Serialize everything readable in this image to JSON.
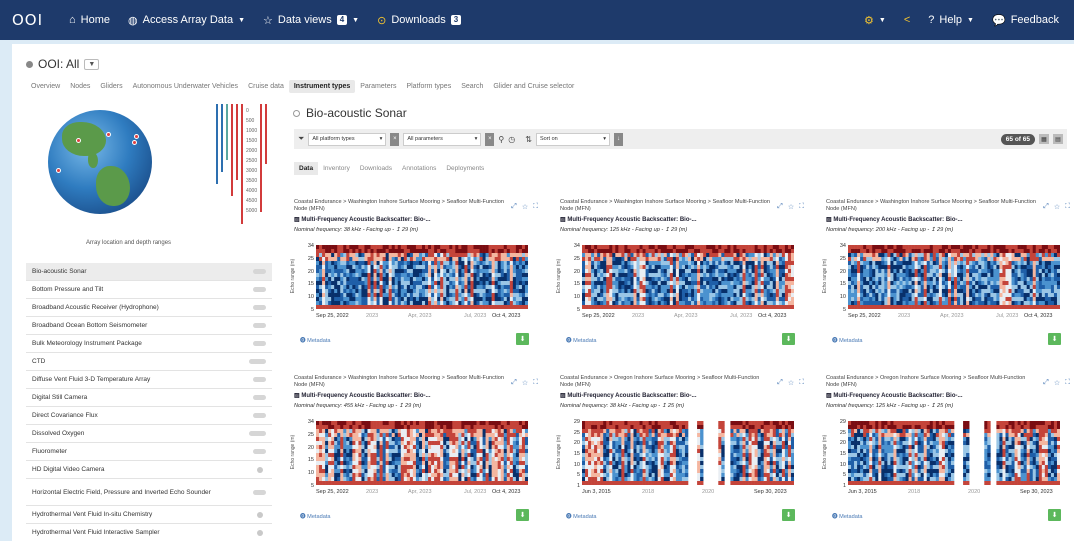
{
  "nav": {
    "logo": "OOI",
    "home": "Home",
    "access": "Access Array Data",
    "views": "Data views",
    "views_count": "4",
    "downloads": "Downloads",
    "downloads_count": "3",
    "help": "Help",
    "feedback": "Feedback"
  },
  "selector": {
    "label": "OOI: All"
  },
  "tabs": [
    "Overview",
    "Nodes",
    "Gliders",
    "Autonomous Underwater Vehicles",
    "Cruise data",
    "Instrument types",
    "Parameters",
    "Platform types",
    "Search",
    "Glider and Cruise selector"
  ],
  "active_tab": "Instrument types",
  "map": {
    "caption": "Array location and depth ranges",
    "depths": [
      "0",
      "500",
      "1000",
      "1500",
      "2000",
      "2500",
      "3000",
      "3500",
      "4000",
      "4500",
      "5000"
    ]
  },
  "instruments": [
    {
      "name": "Bio-acoustic Sonar",
      "active": true
    },
    {
      "name": "Bottom Pressure and Tilt"
    },
    {
      "name": "Broadband Acoustic Receiver (Hydrophone)"
    },
    {
      "name": "Broadband Ocean Bottom Seismometer"
    },
    {
      "name": "Bulk Meteorology Instrument Package"
    },
    {
      "name": "CTD"
    },
    {
      "name": "Diffuse Vent Fluid 3-D Temperature Array"
    },
    {
      "name": "Digital Still Camera"
    },
    {
      "name": "Direct Covariance Flux"
    },
    {
      "name": "Dissolved Oxygen"
    },
    {
      "name": "Fluorometer"
    },
    {
      "name": "HD Digital Video Camera"
    },
    {
      "name": "Horizontal Electric Field, Pressure and Inverted Echo Sounder"
    },
    {
      "name": "Hydrothermal Vent Fluid In-situ Chemistry"
    },
    {
      "name": "Hydrothermal Vent Fluid Interactive Sampler"
    }
  ],
  "main": {
    "title": "Bio-acoustic Sonar",
    "filter_platform": "All platform types",
    "filter_params": "All parameters",
    "sort": "Sort on",
    "count": "65 of 65",
    "subtabs": [
      "Data",
      "Inventory",
      "Downloads",
      "Annotations",
      "Deployments"
    ]
  },
  "cards": [
    {
      "path": "Coastal Endurance > Washington Inshore Surface Mooring > Seafloor Multi-Function Node (MFN)",
      "title": "Multi-Frequency Acoustic Backscatter: Bio-...",
      "subtitle": "Nominal frequency: 38 kHz - Facing up - ↥ 29 (m)",
      "ylabel": "Echo range (m)",
      "yticks": [
        "34",
        "25",
        "20",
        "15",
        "10",
        "5"
      ],
      "xticks": [
        "Sep 25, 2022",
        "2023",
        "Apr, 2023",
        "Jul, 2023",
        "Oct 4, 2023"
      ],
      "meta": "Metadata"
    },
    {
      "path": "Coastal Endurance > Washington Inshore Surface Mooring > Seafloor Multi-Function Node (MFN)",
      "title": "Multi-Frequency Acoustic Backscatter: Bio-...",
      "subtitle": "Nominal frequency: 125 kHz - Facing up - ↥ 29 (m)",
      "ylabel": "Echo range (m)",
      "yticks": [
        "34",
        "25",
        "20",
        "15",
        "10",
        "5"
      ],
      "xticks": [
        "Sep 25, 2022",
        "2023",
        "Apr, 2023",
        "Jul, 2023",
        "Oct 4, 2023"
      ],
      "meta": "Metadata"
    },
    {
      "path": "Coastal Endurance > Washington Inshore Surface Mooring > Seafloor Multi-Function Node (MFN)",
      "title": "Multi-Frequency Acoustic Backscatter: Bio-...",
      "subtitle": "Nominal frequency: 200 kHz - Facing up - ↥ 29 (m)",
      "ylabel": "Echo range (m)",
      "yticks": [
        "34",
        "25",
        "20",
        "15",
        "10",
        "5"
      ],
      "xticks": [
        "Sep 25, 2022",
        "2023",
        "Apr, 2023",
        "Jul, 2023",
        "Oct 4, 2023"
      ],
      "meta": "Metadata"
    },
    {
      "path": "Coastal Endurance > Washington Inshore Surface Mooring > Seafloor Multi-Function Node (MFN)",
      "title": "Multi-Frequency Acoustic Backscatter: Bio-...",
      "subtitle": "Nominal frequency: 455 kHz - Facing up - ↥ 29 (m)",
      "ylabel": "Echo range (m)",
      "yticks": [
        "34",
        "25",
        "20",
        "15",
        "10",
        "5"
      ],
      "xticks": [
        "Sep 25, 2022",
        "2023",
        "Apr, 2023",
        "Jul, 2023",
        "Oct 4, 2023"
      ],
      "meta": "Metadata"
    },
    {
      "path": "Coastal Endurance > Oregon Inshore Surface Mooring > Seafloor Multi-Function Node (MFN)",
      "title": "Multi-Frequency Acoustic Backscatter: Bio-...",
      "subtitle": "Nominal frequency: 38 kHz - Facing up - ↥ 25 (m)",
      "ylabel": "Echo range (m)",
      "yticks": [
        "29",
        "25",
        "20",
        "15",
        "10",
        "5",
        "1"
      ],
      "xticks": [
        "Jun 3, 2015",
        "2018",
        "2020",
        "Sep 30, 2023"
      ],
      "meta": "Metadata"
    },
    {
      "path": "Coastal Endurance > Oregon Inshore Surface Mooring > Seafloor Multi-Function Node (MFN)",
      "title": "Multi-Frequency Acoustic Backscatter: Bio-...",
      "subtitle": "Nominal frequency: 125 kHz - Facing up - ↥ 25 (m)",
      "ylabel": "Echo range (m)",
      "yticks": [
        "29",
        "25",
        "20",
        "15",
        "10",
        "5",
        "1"
      ],
      "xticks": [
        "Jun 3, 2015",
        "2018",
        "2020",
        "Sep 30, 2023"
      ],
      "meta": "Metadata"
    }
  ]
}
